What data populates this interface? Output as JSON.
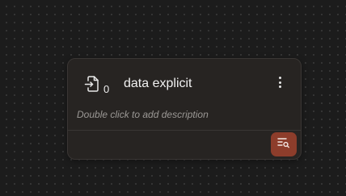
{
  "node": {
    "icon": "file-import-icon",
    "count": "0",
    "title": "data explicit",
    "description_placeholder": "Double click to add description",
    "menu_icon": "more-vertical-icon",
    "action_icon": "list-search-icon",
    "action_color": "#8d3d2b"
  }
}
